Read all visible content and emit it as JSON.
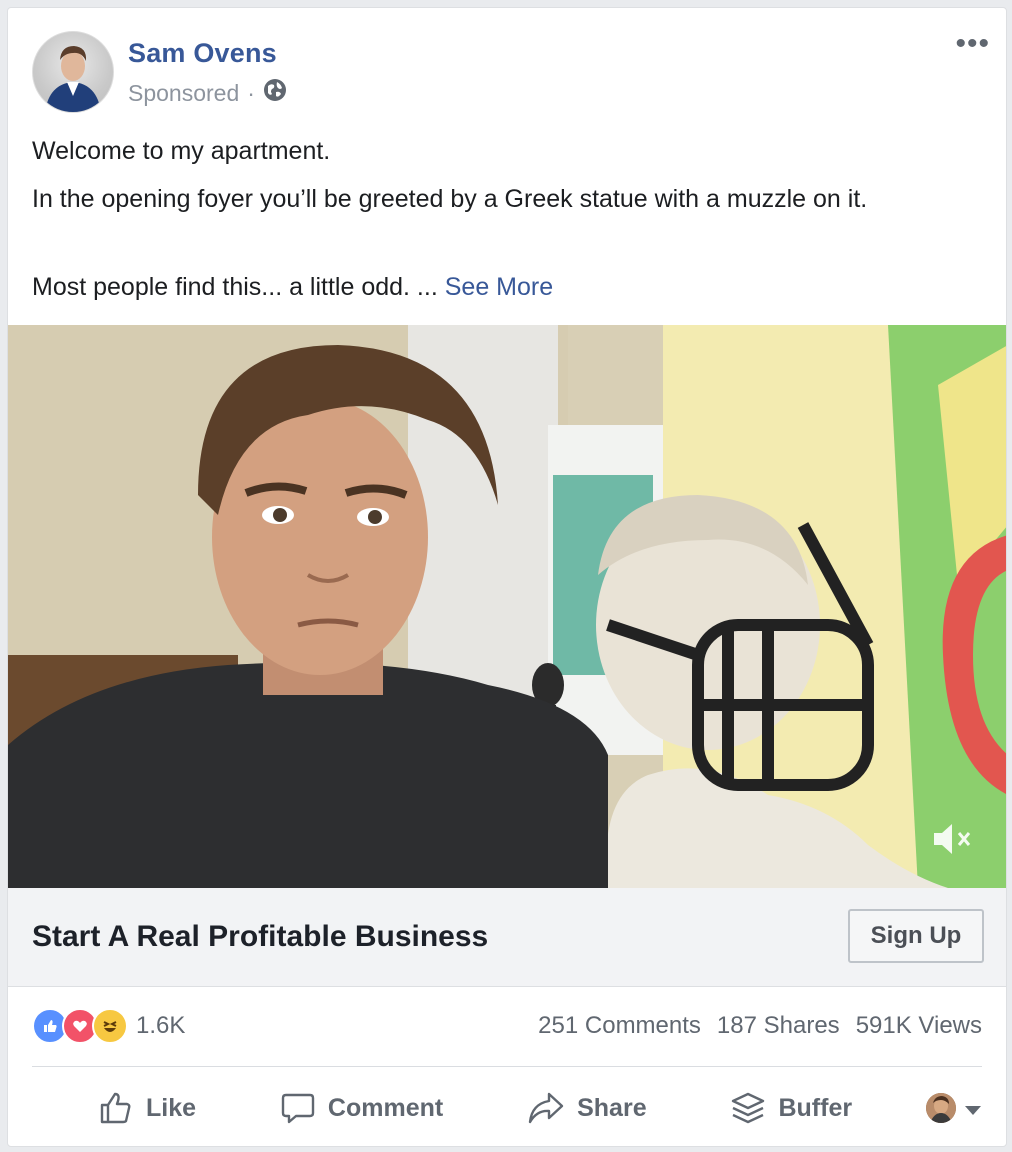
{
  "post": {
    "author": "Sam Ovens",
    "sponsored": "Sponsored",
    "separator": "·",
    "body": {
      "line1": "Welcome to my apartment.",
      "line2": "In the opening foyer you’ll be greeted by a Greek statue with a muzzle on it.",
      "line3": "Most people find this... a little odd. ...",
      "see_more": "See More"
    }
  },
  "media": {
    "type": "video",
    "muted": true
  },
  "cta": {
    "headline": "Start A Real Profitable Business",
    "button": "Sign Up"
  },
  "stats": {
    "reactions_count": "1.6K",
    "comments": "251 Comments",
    "shares": "187 Shares",
    "views": "591K Views"
  },
  "actions": {
    "like": "Like",
    "comment": "Comment",
    "share": "Share",
    "buffer": "Buffer"
  },
  "colors": {
    "link": "#385898",
    "muted": "#606770",
    "like": "#5890ff",
    "love": "#f25268",
    "haha": "#f7c841"
  }
}
